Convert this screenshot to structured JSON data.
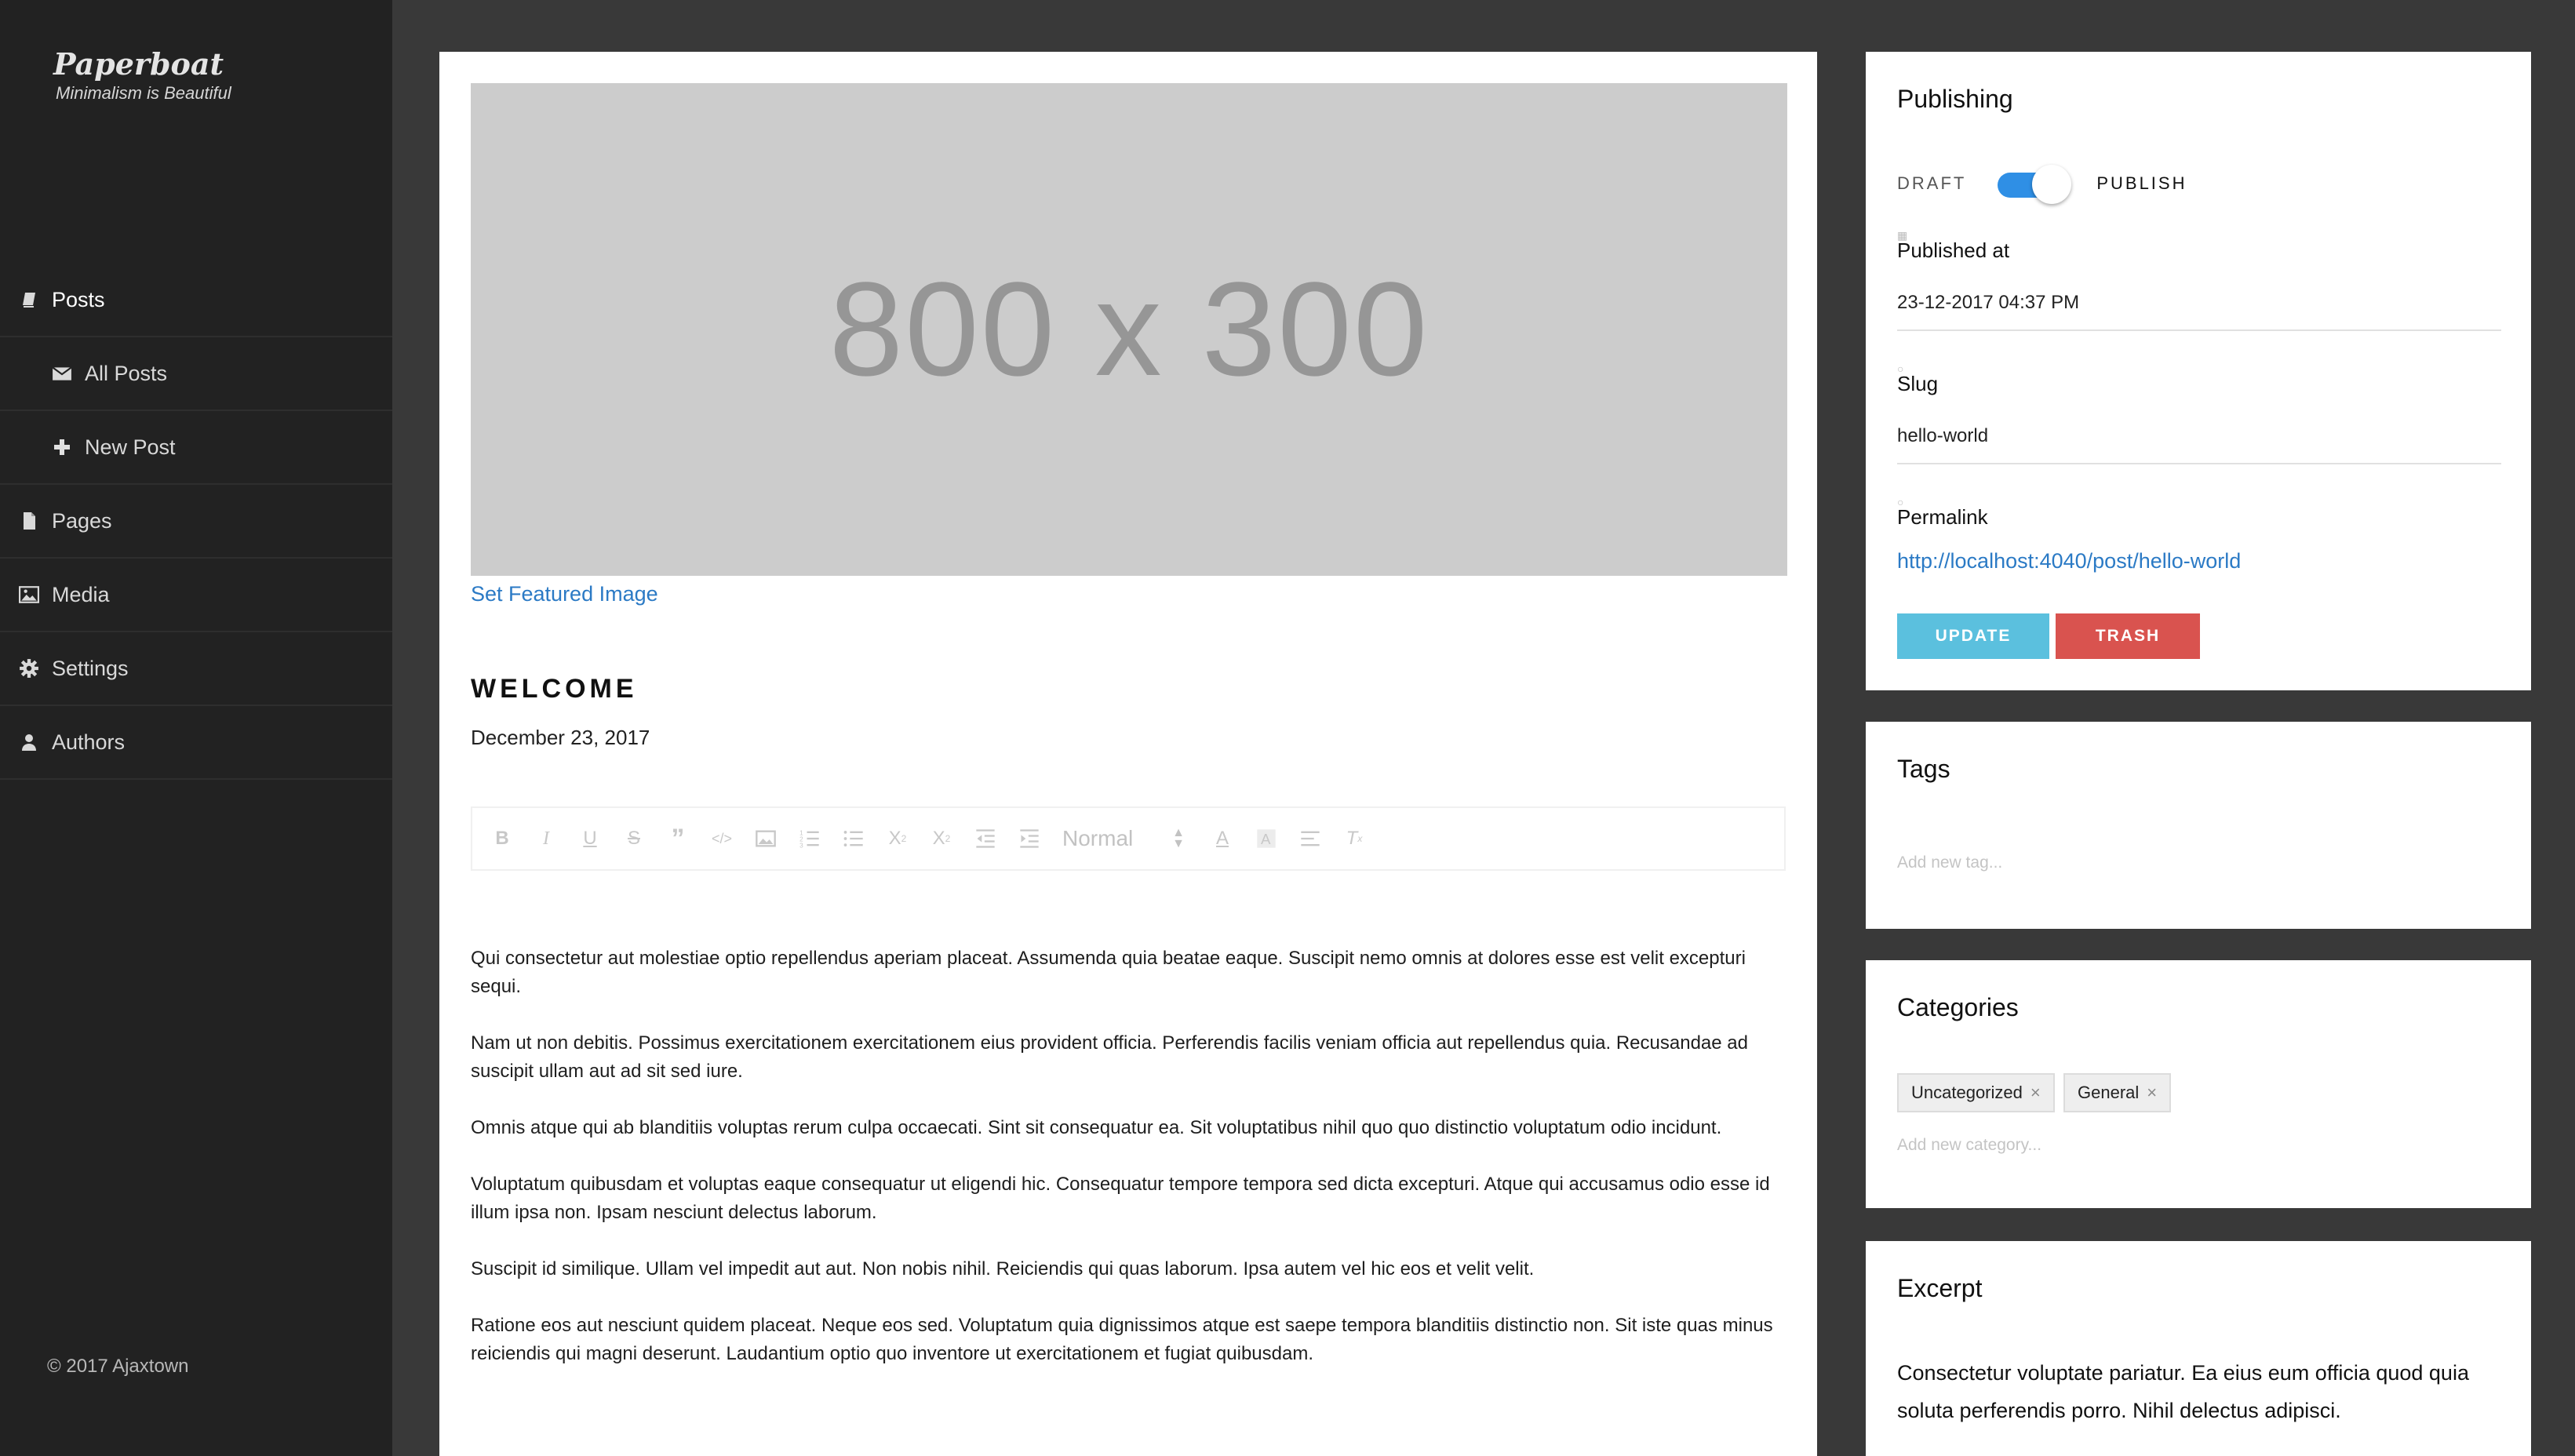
{
  "sidebar": {
    "brand_title": "Paperboat",
    "brand_tagline": "Minimalism is Beautiful",
    "items": [
      {
        "label": "Posts",
        "icon": "book-icon"
      },
      {
        "label": "All Posts",
        "icon": "envelope-icon"
      },
      {
        "label": "New Post",
        "icon": "plus-icon"
      },
      {
        "label": "Pages",
        "icon": "file-icon"
      },
      {
        "label": "Media",
        "icon": "image-icon"
      },
      {
        "label": "Settings",
        "icon": "gear-icon"
      },
      {
        "label": "Authors",
        "icon": "user-icon"
      }
    ],
    "footer": "© 2017 Ajaxtown"
  },
  "editor": {
    "featured_placeholder": "800 x 300",
    "set_featured_label": "Set Featured Image",
    "title": "WELCOME",
    "date": "December 23, 2017",
    "toolbar": {
      "format_select": "Normal",
      "buttons": [
        "bold",
        "italic",
        "underline",
        "strike",
        "blockquote",
        "code",
        "image",
        "ordered-list",
        "bullet-list",
        "subscript",
        "superscript",
        "outdent",
        "indent",
        "font-color",
        "background-color",
        "align",
        "clean"
      ]
    },
    "paragraphs": [
      "Qui consectetur aut molestiae optio repellendus aperiam placeat. Assumenda quia beatae eaque. Suscipit nemo omnis at dolores esse est velit excepturi sequi.",
      "Nam ut non debitis. Possimus exercitationem exercitationem eius provident officia. Perferendis facilis veniam officia aut repellendus quia. Recusandae ad suscipit ullam aut ad sit sed iure.",
      "Omnis atque qui ab blanditiis voluptas rerum culpa occaecati. Sint sit consequatur ea. Sit voluptatibus nihil quo quo distinctio voluptatum odio incidunt.",
      "Voluptatum quibusdam et voluptas eaque consequatur ut eligendi hic. Consequatur tempore tempora sed dicta excepturi. Atque qui accusamus odio esse id illum ipsa non. Ipsam nesciunt delectus laborum.",
      "Suscipit id similique. Ullam vel impedit aut aut. Non nobis nihil. Reiciendis qui quas laborum. Ipsa autem vel hic eos et velit velit.",
      "Ratione eos aut nesciunt quidem placeat. Neque eos sed. Voluptatum quia dignissimos atque est saepe tempora blanditiis distinctio non. Sit iste quas minus reiciendis qui magni deserunt. Laudantium optio quo inventore ut exercitationem et fugiat quibusdam."
    ]
  },
  "publishing": {
    "title": "Publishing",
    "toggle_off_label": "DRAFT",
    "toggle_on_label": "PUBLISH",
    "toggle_state": "publish",
    "published_at_label": "Published at",
    "published_at_value": "23-12-2017 04:37 PM",
    "slug_label": "Slug",
    "slug_value": "hello-world",
    "permalink_label": "Permalink",
    "permalink_value": "http://localhost:4040/post/hello-world",
    "update_label": "UPDATE",
    "trash_label": "TRASH",
    "colors": {
      "toggle": "#2f8fe5",
      "update": "#5bc0de",
      "trash": "#d9534f",
      "link": "#2b7ac5"
    }
  },
  "tags": {
    "title": "Tags",
    "placeholder": "Add new tag..."
  },
  "categories": {
    "title": "Categories",
    "chips": [
      "Uncategorized",
      "General"
    ],
    "placeholder": "Add new category..."
  },
  "excerpt": {
    "title": "Excerpt",
    "text": "Consectetur voluptate pariatur. Ea eius eum officia quod quia soluta perferendis porro. Nihil delectus adipisci."
  }
}
